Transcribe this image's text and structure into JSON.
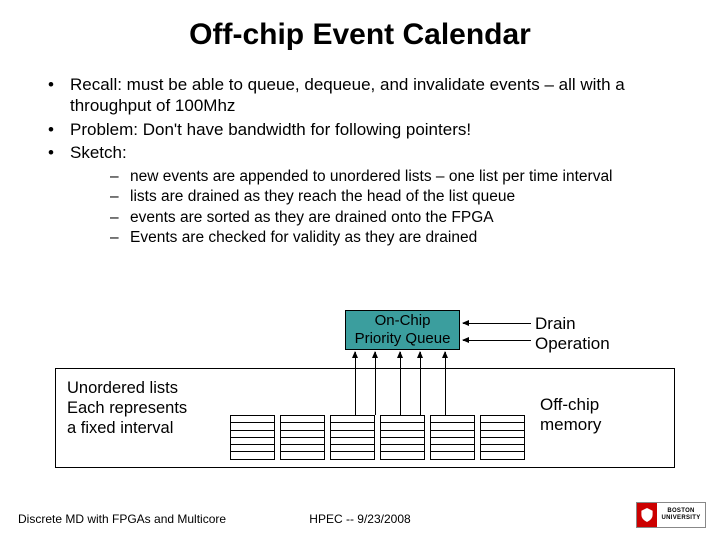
{
  "title": "Off-chip Event Calendar",
  "bullets": {
    "b0": "Recall:  must be able to queue, dequeue, and invalidate events – all with a throughput of 100Mhz",
    "b1": "Problem:  Don't have bandwidth for following pointers!",
    "b2": "Sketch:"
  },
  "sub": {
    "s0": "new events are appended to unordered lists – one list per time interval",
    "s1": "lists are drained as they reach the head of the list queue",
    "s2": "events are sorted as they are drained onto the FPGA",
    "s3": "Events are checked for validity as they are drained"
  },
  "diagram": {
    "pq_line1": "On-Chip",
    "pq_line2": "Priority Queue",
    "drain_line1": "Drain",
    "drain_line2": "Operation",
    "ul_line1": "Unordered lists",
    "ul_line2": "Each represents",
    "ul_line3": "a fixed interval",
    "mem_line1": "Off-chip",
    "mem_line2": "memory"
  },
  "footer": {
    "left": "Discrete MD with FPGAs and Multicore",
    "center": "HPEC  --  9/23/2008",
    "logo_top": "BOSTON",
    "logo_bot": "UNIVERSITY"
  }
}
